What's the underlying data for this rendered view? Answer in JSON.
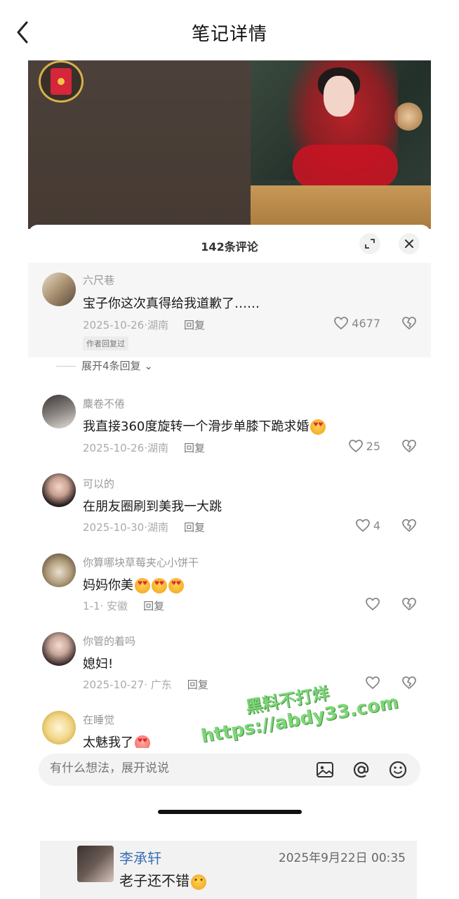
{
  "nav": {
    "title": "笔记详情"
  },
  "sheet": {
    "comment_count_label": "142条评论"
  },
  "comments": [
    {
      "user": "六尺巷",
      "text": "宝子你这次真得给我道歉了……",
      "date": "2025-10-26",
      "location": "湖南",
      "reply_label": "回复",
      "likes": "4677",
      "author_tag": "作者回复过"
    },
    {
      "user": "麋卷不倦",
      "text": "我直接360度旋转一个滑步单膝下跪求婚",
      "date": "2025-10-26",
      "location": "湖南",
      "reply_label": "回复",
      "likes": "25"
    },
    {
      "user": "可以的",
      "text": "在朋友圈刷到美我一大跳",
      "date": "2025-10-30",
      "location": "湖南",
      "reply_label": "回复",
      "likes": "4"
    },
    {
      "user": "你算哪块草莓夹心小饼干",
      "text": "妈妈你美",
      "date": "1-1",
      "location": "安徽",
      "reply_label": "回复",
      "likes": ""
    },
    {
      "user": "你管的着吗",
      "text": "媳妇!",
      "date": "2025-10-27",
      "location": "广东",
      "reply_label": "回复",
      "likes": ""
    },
    {
      "user": "在睡觉",
      "text": "太魅我了"
    }
  ],
  "expand_replies_label": "展开4条回复",
  "input": {
    "placeholder": "有什么想法，展开说说"
  },
  "watermark": {
    "line1": "黑料不打烊",
    "line2": "https://abdy33.com"
  },
  "dm": {
    "name": "李承轩",
    "time": "2025年9月22日 00:35",
    "text": "老子还不错"
  },
  "icons": [
    "back-arrow-icon",
    "red-packet-icon",
    "expand-icon",
    "close-icon",
    "heart-icon",
    "dislike-heart-icon",
    "image-icon",
    "at-icon",
    "emoji-icon"
  ],
  "colors": {
    "accent_green": "#6fd36a",
    "dm_name_blue": "#3b6fb5",
    "red_packet": "#d6263a"
  }
}
